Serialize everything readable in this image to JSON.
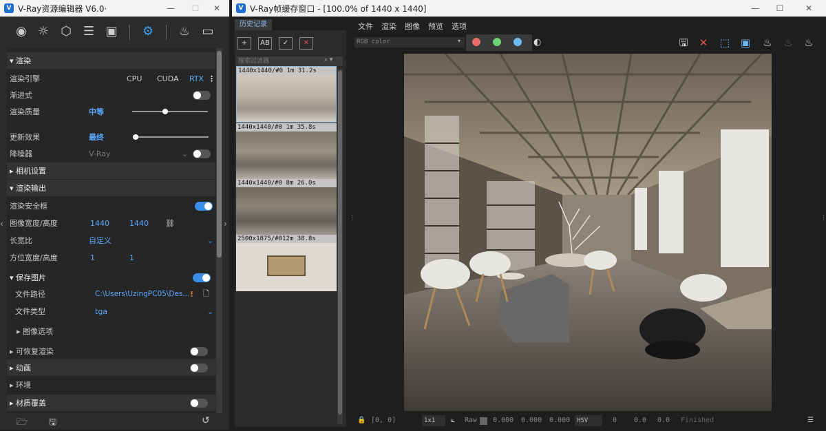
{
  "left_window": {
    "title": "V-Ray资源编辑器 V6.0·",
    "toolbar_icons": [
      "sphere-icon",
      "light-bulb-icon",
      "cube-icon",
      "layers-icon",
      "texture-icon",
      "settings-gear-icon",
      "teapot-render-icon",
      "frame-buffer-icon"
    ],
    "sections": {
      "render": "渲染",
      "camera": "相机设置",
      "render_output": "渲染输出",
      "save_image": "保存图片",
      "image_options": "图像选项",
      "resumable": "可恢复渲染",
      "animation": "动画",
      "environment": "环境",
      "material_override": "材质覆盖"
    },
    "engine": {
      "label": "渲染引擎",
      "options": [
        "CPU",
        "CUDA",
        "RTX"
      ],
      "selected": "RTX"
    },
    "progressive": {
      "label": "渐进式",
      "on": false
    },
    "quality": {
      "label": "渲染质量",
      "value": "中等",
      "slider": 0.42
    },
    "update": {
      "label": "更新效果",
      "value": "最终",
      "slider": 0.03
    },
    "denoiser": {
      "label": "降噪器",
      "value": "V-Ray",
      "on": false
    },
    "safe_frame": {
      "label": "渲染安全框",
      "on": true
    },
    "image_size": {
      "label": "图像宽度/高度",
      "width": "1440",
      "height": "1440"
    },
    "aspect": {
      "label": "长宽比",
      "value": "自定义"
    },
    "pixel_aspect": {
      "label": "方位宽度/高度",
      "a": "1",
      "b": "1"
    },
    "save_image_on": true,
    "file_path": {
      "label": "文件路径",
      "value": "C:\\Users\\UzingPC05\\Des..."
    },
    "file_type": {
      "label": "文件类型",
      "value": "tga"
    },
    "resumable_on": false,
    "animation_on": false,
    "material_override_on": false
  },
  "right_window": {
    "title": "V-Ray帧缓存窗口 - [100.0% of 1440 x 1440]",
    "history_tab": "历史记录",
    "filter_placeholder": "搜索过滤器",
    "history": [
      {
        "caption": "1440x1440/#0 1m 31.2s"
      },
      {
        "caption": "1440x1440/#0 1m 35.8s"
      },
      {
        "caption": "1440x1440/#0 8m 26.0s"
      },
      {
        "caption": "2500x1875/#012m 38.8s"
      }
    ],
    "menu": [
      "文件",
      "渲染",
      "图像",
      "预览",
      "选项"
    ],
    "channel": "RGB color",
    "status": {
      "coords": "[0, 0]",
      "zoom": "1x1",
      "raw": "Raw",
      "r": "0.000",
      "g": "0.000",
      "b": "0.000",
      "mode": "HSV",
      "h": "0",
      "s": "0.0",
      "v": "0.0",
      "state": "Finished"
    }
  }
}
